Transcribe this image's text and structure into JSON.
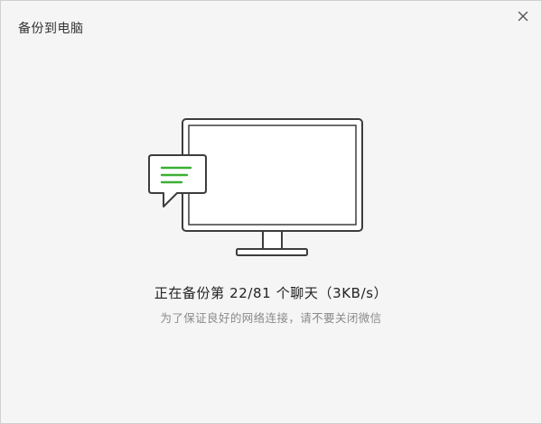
{
  "window": {
    "title": "备份到电脑"
  },
  "icons": {
    "close": "close-icon",
    "illustration": "computer-with-chat-bubble-icon"
  },
  "backup": {
    "status_text": "正在备份第 22/81 个聊天（3KB/s）",
    "hint_text": "为了保证良好的网络连接，请不要关闭微信"
  },
  "colors": {
    "accent": "#3cb034",
    "outline": "#3d3d3d",
    "background": "#f5f5f5"
  }
}
